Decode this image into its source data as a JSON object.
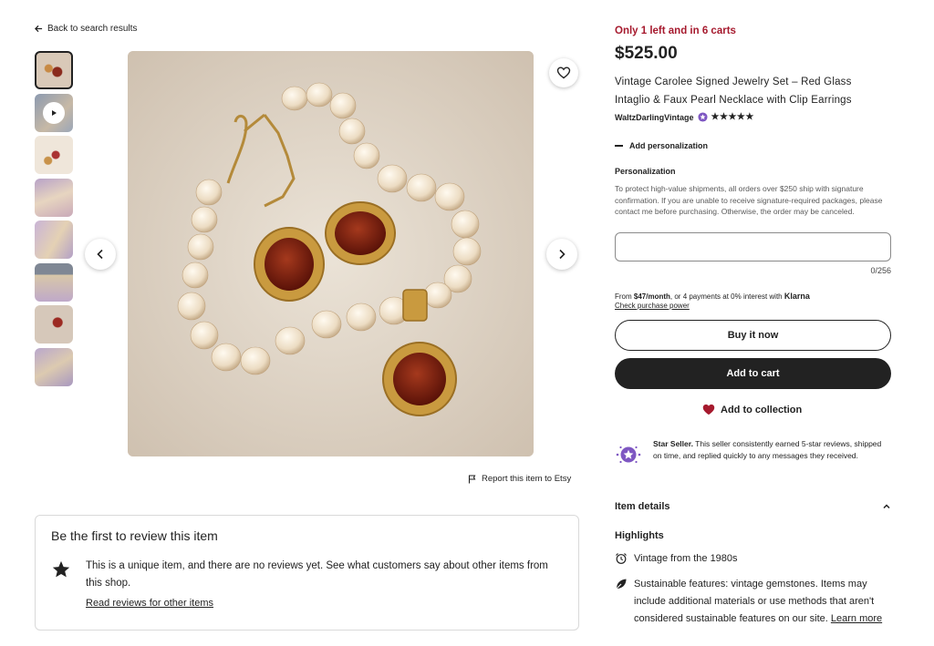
{
  "nav": {
    "back_label": "Back to search results"
  },
  "gallery": {
    "thumbnail_count": 8,
    "active_index": 0,
    "video_index": 1
  },
  "report": {
    "label": "Report this item to Etsy"
  },
  "reviews": {
    "heading": "Be the first to review this item",
    "body": "This is a unique item, and there are no reviews yet. See what customers say about other items from this shop.",
    "link": "Read reviews for other items"
  },
  "listing": {
    "stock_notice": "Only 1 left and in 6 carts",
    "price": "$525.00",
    "title": "Vintage Carolee Signed Jewelry Set – Red Glass Intaglio & Faux Pearl Necklace with Clip Earrings",
    "shop_name": "WaltzDarlingVintage",
    "rating_stars": "★★★★★"
  },
  "personalization": {
    "toggle_label": "Add personalization",
    "label": "Personalization",
    "help": "To protect high-value shipments, all orders over $250 ship with signature confirmation. If you are unable to receive signature-required packages, please contact me before purchasing. Otherwise, the order may be canceled.",
    "value": "",
    "counter": "0/256"
  },
  "klarna": {
    "text_prefix": "From ",
    "amount": "$47/month",
    "text_suffix": ", or 4 payments at 0% interest with ",
    "brand": "Klarna",
    "check_link": "Check purchase power"
  },
  "actions": {
    "buy_now": "Buy it now",
    "add_to_cart": "Add to cart",
    "add_to_collection": "Add to collection"
  },
  "star_seller": {
    "title": "Star Seller.",
    "text": " This seller consistently earned 5-star reviews, shipped on time, and replied quickly to any messages they received."
  },
  "item_details": {
    "heading": "Item details",
    "highlights_heading": "Highlights",
    "highlight_1": "Vintage from the 1980s",
    "highlight_2": "Sustainable features: vintage gemstones. Items may include additional materials or use methods that aren't considered sustainable features on our site.",
    "learn_more": "Learn more"
  },
  "colors": {
    "stock_red": "#a61a2e",
    "dark_button": "#222222",
    "heart_red": "#a61a2e",
    "star_seller_purple": "#7e57c2"
  },
  "icons": {
    "back": "arrow-left-icon",
    "favorite": "heart-outline-icon",
    "prev": "chevron-left-icon",
    "next": "chevron-right-icon",
    "flag": "flag-icon",
    "review_star": "star-icon",
    "collection": "heart-filled-icon",
    "star_seller": "star-seller-badge-icon",
    "collapse": "chevron-up-icon",
    "alarm": "alarm-clock-icon",
    "leaf": "leaf-icon"
  }
}
